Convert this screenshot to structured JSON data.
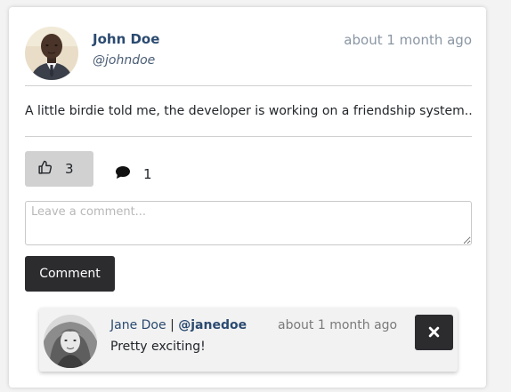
{
  "post": {
    "author": {
      "name": "John Doe",
      "handle": "@johndoe"
    },
    "time": "about 1 month ago",
    "body": "A little birdie told me, the developer is working on a friendship system..",
    "likes": "3",
    "comments_count": "1"
  },
  "comment_form": {
    "placeholder": "Leave a comment...",
    "value": "",
    "submit_label": "Comment"
  },
  "comments": [
    {
      "author_name": "Jane Doe",
      "separator": "|",
      "author_handle": "@janedoe",
      "time": "about 1 month ago",
      "text": "Pretty exciting!"
    }
  ],
  "icons": {
    "like": "thumbs-up-icon",
    "comments": "speech-bubble-icon",
    "delete": "close-icon"
  },
  "colors": {
    "link": "#2b4a70",
    "muted": "#8a96a3",
    "dark_button": "#2c2c2f",
    "like_button": "#d1d1d1"
  }
}
